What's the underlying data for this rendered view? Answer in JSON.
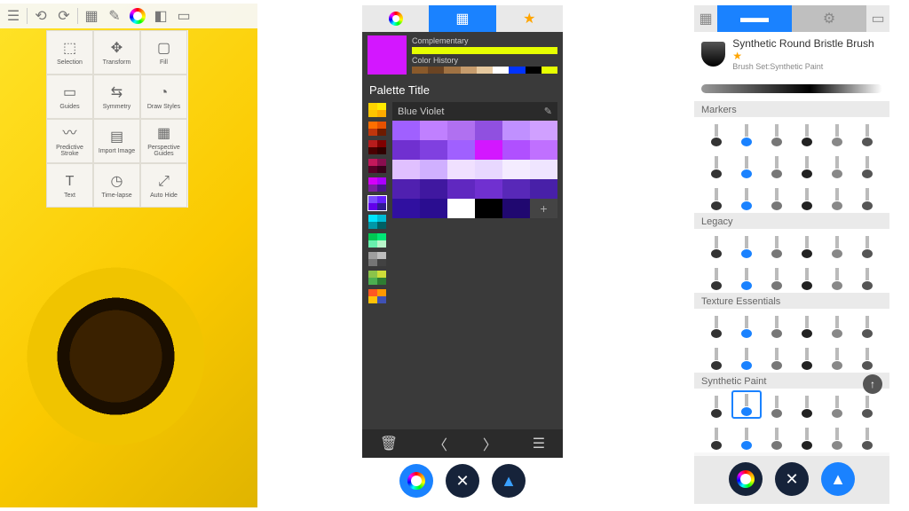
{
  "panelA": {
    "toolbar_icons": [
      "menu",
      "undo",
      "redo",
      "grid",
      "pen",
      "color",
      "layers",
      "fullscreen"
    ],
    "tools": [
      {
        "label": "Selection",
        "icon": "select"
      },
      {
        "label": "Transform",
        "icon": "transform"
      },
      {
        "label": "Fill",
        "icon": "fill"
      },
      {
        "label": "Guides",
        "icon": "guides"
      },
      {
        "label": "Symmetry",
        "icon": "symmetry"
      },
      {
        "label": "Draw Styles",
        "icon": "drawstyles"
      },
      {
        "label": "Predictive Stroke",
        "icon": "predictive"
      },
      {
        "label": "Import Image",
        "icon": "import"
      },
      {
        "label": "Perspective Guides",
        "icon": "perspective"
      },
      {
        "label": "Text",
        "icon": "text"
      },
      {
        "label": "Time-lapse",
        "icon": "timelapse"
      },
      {
        "label": "Auto Hide",
        "icon": "autohide"
      }
    ]
  },
  "panelB": {
    "tabs": [
      "wheel",
      "grid",
      "star"
    ],
    "active_tab": 1,
    "current_color": "#d317ff",
    "complementary_label": "Complementary",
    "complementary_colors": [
      "#e6ff00",
      "#e6ff00",
      "#e6ff00",
      "#e6ff00",
      "#e6ff00",
      "#e6ff00",
      "#e6ff00",
      "#e6ff00"
    ],
    "history_label": "Color History",
    "history_colors": [
      "#8a5a2b",
      "#6b4423",
      "#a07243",
      "#c69c6d",
      "#e6c99f",
      "#ffffff",
      "#0033ff",
      "#000000",
      "#e6ff00"
    ],
    "section_title": "Palette Title",
    "selected_palette_name": "Blue Violet",
    "thumb_palettes": [
      [
        "#ffd400",
        "#ffea00",
        "#ffc400",
        "#ffab00"
      ],
      [
        "#ff6f00",
        "#e65100",
        "#bf360c",
        "#6d1b00"
      ],
      [
        "#b71c1c",
        "#7f0000",
        "#4a0000",
        "#300000"
      ],
      [
        "#c2185b",
        "#880e4f",
        "#560027",
        "#38001a"
      ],
      [
        "#d500f9",
        "#aa00ff",
        "#7b1fa2",
        "#4a148c"
      ],
      [
        "#7c4dff",
        "#651fff",
        "#6200ea",
        "#311b92"
      ],
      [
        "#00e5ff",
        "#00bcd4",
        "#0097a7",
        "#006064"
      ],
      [
        "#00c853",
        "#00e676",
        "#69f0ae",
        "#b9f6ca"
      ],
      [
        "#9e9e9e",
        "#bdbdbd",
        "#757575",
        "#424242"
      ],
      [
        "#8bc34a",
        "#cddc39",
        "#4caf50",
        "#2e7d32"
      ],
      [
        "#ff5722",
        "#ff9800",
        "#ffc107",
        "#3f51b5"
      ]
    ],
    "selected_thumb_index": 5,
    "palette_cells": [
      "#a060ff",
      "#c080ff",
      "#b070f0",
      "#9050e0",
      "#c090ff",
      "#d0a0ff",
      "#7030d0",
      "#8040e0",
      "#a060ff",
      "#d317ff",
      "#b050ff",
      "#c070ff",
      "#e0c0ff",
      "#d0b0ff",
      "#f0e0ff",
      "#e8d8ff",
      "#f4ecff",
      "#efe5ff",
      "#5020b0",
      "#4018a0",
      "#6028c0",
      "#7030d0",
      "#5828b8",
      "#4820a8",
      "#3010a0",
      "#2a0d90",
      "#ffffff",
      "#000000",
      "#200870"
    ],
    "footer_icons": [
      "trash",
      "prev",
      "next",
      "menu"
    ],
    "fabs": [
      "color-wheel",
      "close",
      "layers"
    ]
  },
  "panelC": {
    "tabs": [
      "brushes",
      "sliders"
    ],
    "active_tab": 0,
    "brush_name": "Synthetic Round Bristle Brush",
    "brush_favorite": true,
    "brush_set_label": "Brush Set:Synthetic Paint",
    "categories": [
      {
        "name": "Markers",
        "rows": 3,
        "cols": 6
      },
      {
        "name": "Legacy",
        "rows": 2,
        "cols": 6
      },
      {
        "name": "Texture Essentials",
        "rows": 2,
        "cols": 6
      },
      {
        "name": "Synthetic Paint",
        "rows": 2,
        "cols": 6
      }
    ],
    "selected_category": "Synthetic Paint",
    "selected_index": 1,
    "fabs": [
      "color-wheel",
      "close",
      "layers"
    ]
  }
}
